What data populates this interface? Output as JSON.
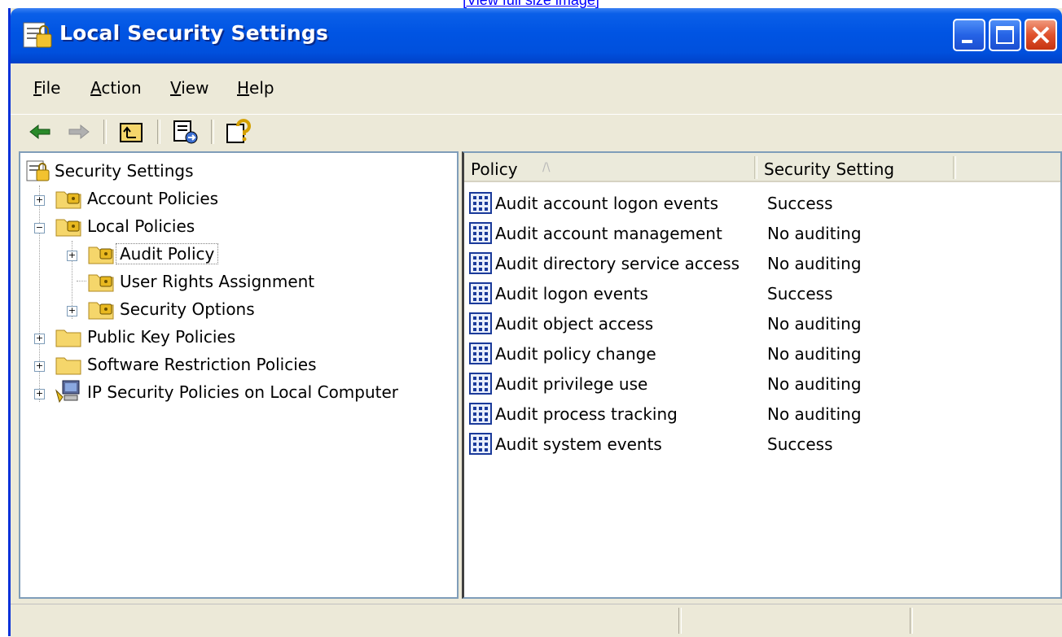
{
  "top_link": "[View full size image]",
  "window": {
    "title": "Local Security Settings",
    "title_icon": "security-settings-icon"
  },
  "menu": [
    {
      "label_first": "F",
      "label_rest": "ile"
    },
    {
      "label_first": "A",
      "label_rest": "ction"
    },
    {
      "label_first": "V",
      "label_rest": "iew"
    },
    {
      "label_first": "H",
      "label_rest": "elp"
    }
  ],
  "toolbar": {
    "icons": [
      "back-arrow-icon",
      "forward-arrow-icon",
      "up-folder-icon",
      "export-list-icon",
      "help-icon"
    ]
  },
  "tree": {
    "root": "Security Settings",
    "account_policies": "Account Policies",
    "local_policies": "Local Policies",
    "audit_policy": "Audit Policy",
    "user_rights": "User Rights Assignment",
    "security_options": "Security Options",
    "public_key": "Public Key Policies",
    "software_restriction": "Software Restriction Policies",
    "ip_security": "IP Security Policies on Local Computer"
  },
  "list": {
    "col_policy": "Policy",
    "col_setting": "Security Setting",
    "sort_indicator": "/\\",
    "rows": [
      {
        "policy": "Audit account logon events",
        "setting": "Success"
      },
      {
        "policy": "Audit account management",
        "setting": "No auditing"
      },
      {
        "policy": "Audit directory service access",
        "setting": "No auditing"
      },
      {
        "policy": "Audit logon events",
        "setting": "Success"
      },
      {
        "policy": "Audit object access",
        "setting": "No auditing"
      },
      {
        "policy": "Audit policy change",
        "setting": "No auditing"
      },
      {
        "policy": "Audit privilege use",
        "setting": "No auditing"
      },
      {
        "policy": "Audit process tracking",
        "setting": "No auditing"
      },
      {
        "policy": "Audit system events",
        "setting": "Success"
      }
    ]
  },
  "colors": {
    "titlebar": "#0054e3",
    "close_button": "#e0522d",
    "folder": "#f5d66b"
  }
}
